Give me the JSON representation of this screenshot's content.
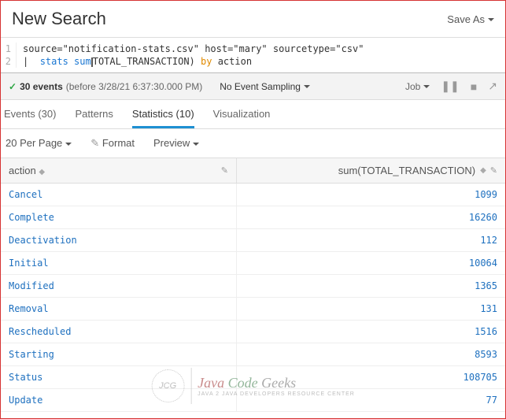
{
  "header": {
    "title": "New Search",
    "save_as": "Save As"
  },
  "query": {
    "line1_n": "1",
    "line2_n": "2",
    "line1": "source=\"notification-stats.csv\" host=\"mary\" sourcetype=\"csv\"",
    "stats_kw": "stats",
    "sum_kw": "sum",
    "sum_arg_open": "(",
    "sum_arg": "TOTAL_TRANSACTION)",
    "by_kw": "by",
    "field": "action"
  },
  "status": {
    "events": "30 events",
    "time": "(before 3/28/21 6:37:30.000 PM)",
    "sampling": "No Event Sampling",
    "job": "Job"
  },
  "tabs": {
    "events": "Events (30)",
    "patterns": "Patterns",
    "statistics": "Statistics (10)",
    "visualization": "Visualization"
  },
  "subbar": {
    "perpage": "20 Per Page",
    "format": "Format",
    "preview": "Preview"
  },
  "table": {
    "h_action": "action",
    "h_value": "sum(TOTAL_TRANSACTION)",
    "rows": [
      {
        "a": "Cancel",
        "v": "1099"
      },
      {
        "a": "Complete",
        "v": "16260"
      },
      {
        "a": "Deactivation",
        "v": "112"
      },
      {
        "a": "Initial",
        "v": "10064"
      },
      {
        "a": "Modified",
        "v": "1365"
      },
      {
        "a": "Removal",
        "v": "131"
      },
      {
        "a": "Rescheduled",
        "v": "1516"
      },
      {
        "a": "Starting",
        "v": "8593"
      },
      {
        "a": "Status",
        "v": "108705"
      },
      {
        "a": "Update",
        "v": "77"
      }
    ]
  },
  "watermark": {
    "jcg": "JCG",
    "java": "Java",
    "code": "Code",
    "geeks": "Geeks",
    "sub": "Java 2 Java Developers Resource Center"
  }
}
